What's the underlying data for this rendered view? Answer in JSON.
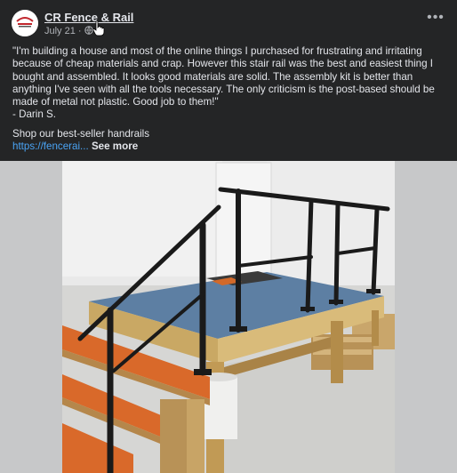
{
  "header": {
    "page_name": "CR Fence & Rail",
    "date": "July 21",
    "more_label": "•••"
  },
  "post": {
    "quote": "\"I'm building a house and most of the online things I purchased for frustrating and irritating because of cheap materials and crap. However this stair rail was the best and easiest thing I bought and assembled. It looks good materials are solid. The assembly kit is better than anything I've seen with all the tools necessary. The only criticism is the post-based should be made of metal not plastic. Good job to them!\"",
    "author": "- Darin S.",
    "shop_text": "Shop our best-seller handrails",
    "link_text": "https://fencerai...",
    "see_more": "See more"
  },
  "colors": {
    "background": "#242526",
    "text": "#e4e6eb",
    "secondary_text": "#b0b3b8",
    "link": "#4aa4f5"
  },
  "icons": {
    "avatar": "cr-fence-rail-logo",
    "privacy": "globe-icon",
    "menu": "more-options-icon",
    "pointer": "hand-cursor-icon"
  }
}
